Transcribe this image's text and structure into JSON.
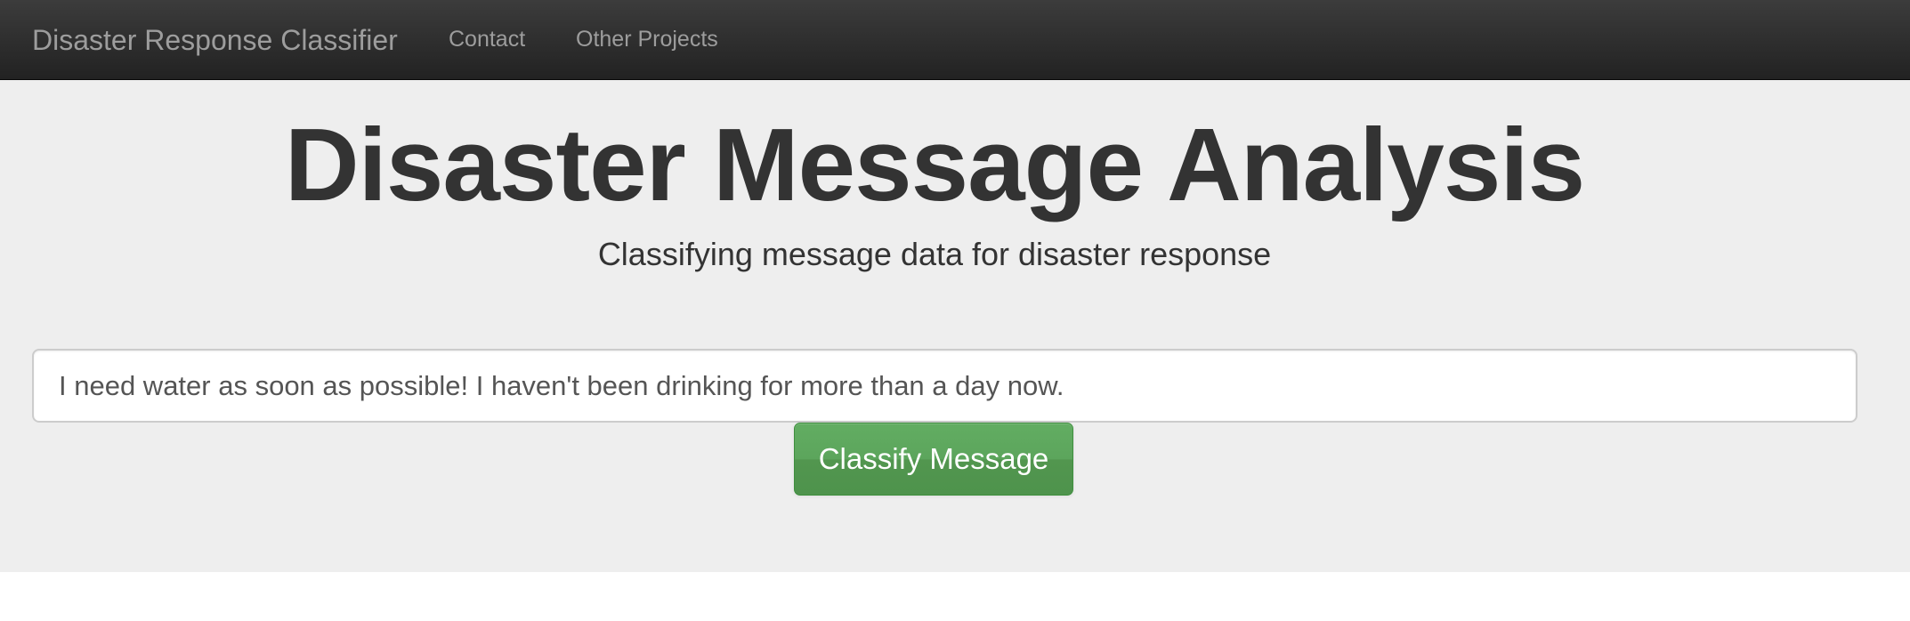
{
  "navbar": {
    "brand": "Disaster Response Classifier",
    "links": [
      {
        "label": "Contact"
      },
      {
        "label": "Other Projects"
      }
    ]
  },
  "hero": {
    "title": "Disaster Message Analysis",
    "subtitle": "Classifying message data for disaster response"
  },
  "form": {
    "query_value": "I need water as soon as possible! I haven't been drinking for more than a day now.",
    "submit_label": "Classify Message"
  },
  "colors": {
    "navbar_bg": "#222222",
    "jumbotron_bg": "#eeeeee",
    "button_green": "#5cb85c",
    "text_dark": "#333333"
  }
}
